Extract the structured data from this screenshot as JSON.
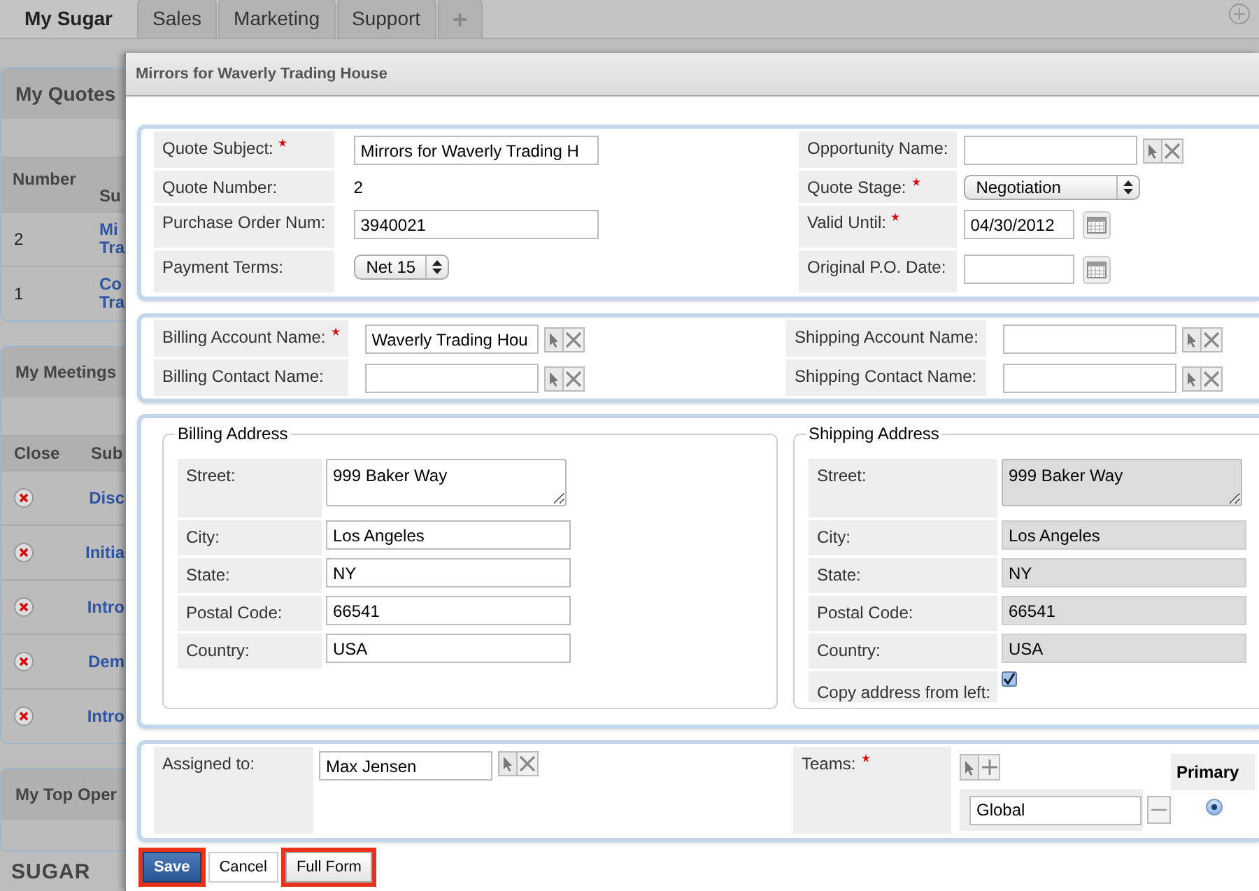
{
  "top_tabs": [
    {
      "label": "My Sugar",
      "selected": true
    },
    {
      "label": "Sales",
      "selected": false
    },
    {
      "label": "Marketing",
      "selected": false
    },
    {
      "label": "Support",
      "selected": false
    },
    {
      "label": "+",
      "selected": false
    }
  ],
  "quotes_dashlet": {
    "title": "My Quotes",
    "columns": [
      "Number",
      "Su"
    ],
    "rows": [
      {
        "number": "2",
        "subject": [
          "Mi",
          "Tra"
        ]
      },
      {
        "number": "1",
        "subject": [
          "Co",
          "Tra"
        ]
      }
    ]
  },
  "meetings_dashlet": {
    "title": "My Meetings",
    "columns": [
      "Close",
      "Sub"
    ],
    "rows": [
      {
        "subject": "Disc"
      },
      {
        "subject": "Initia"
      },
      {
        "subject": "Intro"
      },
      {
        "subject": "Dem"
      },
      {
        "subject": "Intro"
      }
    ]
  },
  "opportunities_dashlet": {
    "title": "My Top Oper"
  },
  "logo": "SUGAR",
  "dialog": {
    "title": "Mirrors for Waverly Trading House",
    "overview": {
      "left": [
        {
          "label": "Quote Subject:",
          "required": true,
          "kind": "text",
          "value": "Mirrors for Waverly Trading H"
        },
        {
          "label": "Quote Number:",
          "required": false,
          "kind": "static",
          "value": "2"
        },
        {
          "label": "Purchase Order Num:",
          "required": false,
          "kind": "text",
          "value": "3940021"
        },
        {
          "label": "Payment Terms:",
          "required": false,
          "kind": "select",
          "value": "Net 15"
        }
      ],
      "right": [
        {
          "label": "Opportunity Name:",
          "required": false,
          "kind": "relate"
        },
        {
          "label": "Quote Stage:",
          "required": true,
          "kind": "select",
          "value": "Negotiation"
        },
        {
          "label": "Valid Until:",
          "required": true,
          "kind": "date",
          "value": "04/30/2012"
        },
        {
          "label": "Original P.O. Date:",
          "required": false,
          "kind": "date"
        }
      ]
    },
    "accounts": {
      "left": [
        {
          "label": "Billing Account Name:",
          "required": true,
          "kind": "relate",
          "value": "Waverly Trading Hou"
        },
        {
          "label": "Billing Contact Name:",
          "required": false,
          "kind": "relate"
        }
      ],
      "right": [
        {
          "label": "Shipping Account Name:",
          "required": false,
          "kind": "relate"
        },
        {
          "label": "Shipping Contact Name:",
          "required": false,
          "kind": "relate"
        }
      ]
    },
    "billing_address": {
      "legend": "Billing Address",
      "disabled": false,
      "fields": [
        {
          "label": "Street:",
          "kind": "textarea",
          "value": "999 Baker Way"
        },
        {
          "label": "City:",
          "kind": "text",
          "value": "Los Angeles"
        },
        {
          "label": "State:",
          "kind": "text",
          "value": "NY"
        },
        {
          "label": "Postal Code:",
          "kind": "text",
          "value": "66541"
        },
        {
          "label": "Country:",
          "kind": "text",
          "value": "USA"
        }
      ]
    },
    "shipping_address": {
      "legend": "Shipping Address",
      "disabled": true,
      "fields": [
        {
          "label": "Street:",
          "kind": "textarea",
          "value": "999 Baker Way"
        },
        {
          "label": "City:",
          "kind": "text",
          "value": "Los Angeles"
        },
        {
          "label": "State:",
          "kind": "text",
          "value": "NY"
        },
        {
          "label": "Postal Code:",
          "kind": "text",
          "value": "66541"
        },
        {
          "label": "Country:",
          "kind": "text",
          "value": "USA"
        }
      ],
      "copy": {
        "label": "Copy address from left:",
        "checked": true
      }
    },
    "assigned": {
      "label": "Assigned to:",
      "required": false,
      "value": "Max Jensen"
    },
    "teams": {
      "label": "Teams:",
      "required": true,
      "primary_header": "Primary",
      "items": [
        {
          "name": "Global",
          "selected": true
        }
      ]
    },
    "buttons": [
      {
        "label": "Save",
        "kind": "primary",
        "highlighted": true
      },
      {
        "label": "Cancel",
        "kind": "plain",
        "highlighted": false
      },
      {
        "label": "Full Form",
        "kind": "secondary",
        "highlighted": true
      }
    ]
  }
}
